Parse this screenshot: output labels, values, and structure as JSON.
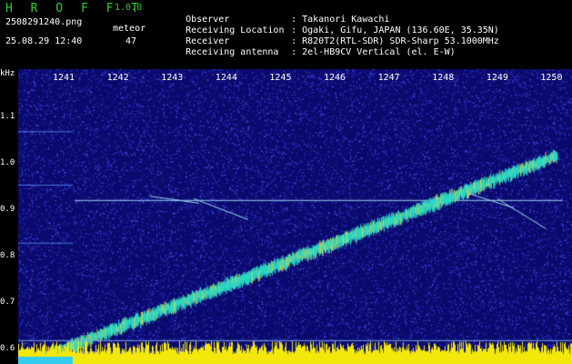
{
  "app": {
    "title": "H R O F F T",
    "version": "1.0.0"
  },
  "file": {
    "name": "2508291240.png",
    "datetime": "25.08.29 12:40"
  },
  "meteor": {
    "label": "meteor",
    "count": "47"
  },
  "meta": [
    {
      "label": "Observer",
      "value": "Takanori Kawachi"
    },
    {
      "label": "Receiving Location",
      "value": "Ogaki, Gifu, JAPAN (136.60E, 35.35N)"
    },
    {
      "label": "Receiver",
      "value": "R820T2(RTL-SDR) SDR-Sharp 53.1000MHz"
    },
    {
      "label": "Receiving antenna",
      "value": "2el-HB9CV Vertical (el. E-W)"
    }
  ],
  "separator": ":",
  "spectrogram": {
    "y_unit": "kHz",
    "y_ticks": [
      "1.1",
      "1.0",
      "0.9",
      "0.8",
      "0.7",
      "0.6"
    ],
    "y_tick_values": [
      1.1,
      1.0,
      0.9,
      0.8,
      0.7,
      0.6
    ],
    "x_ticks": [
      "1241",
      "1242",
      "1243",
      "1244",
      "1245",
      "1246",
      "1247",
      "1248",
      "1249",
      "1250"
    ],
    "x_tick_values": [
      1241,
      1242,
      1243,
      1244,
      1245,
      1246,
      1247,
      1248,
      1249,
      1250
    ],
    "colors": {
      "background": "#0a0a6e",
      "noise": "#3a3ad8",
      "signal": "#29d8c8",
      "signal_hot": "#e8d43c",
      "carrier": "#9ad8f0",
      "power_bar": "#f4e80a",
      "power_base": "#33ccee"
    }
  }
}
